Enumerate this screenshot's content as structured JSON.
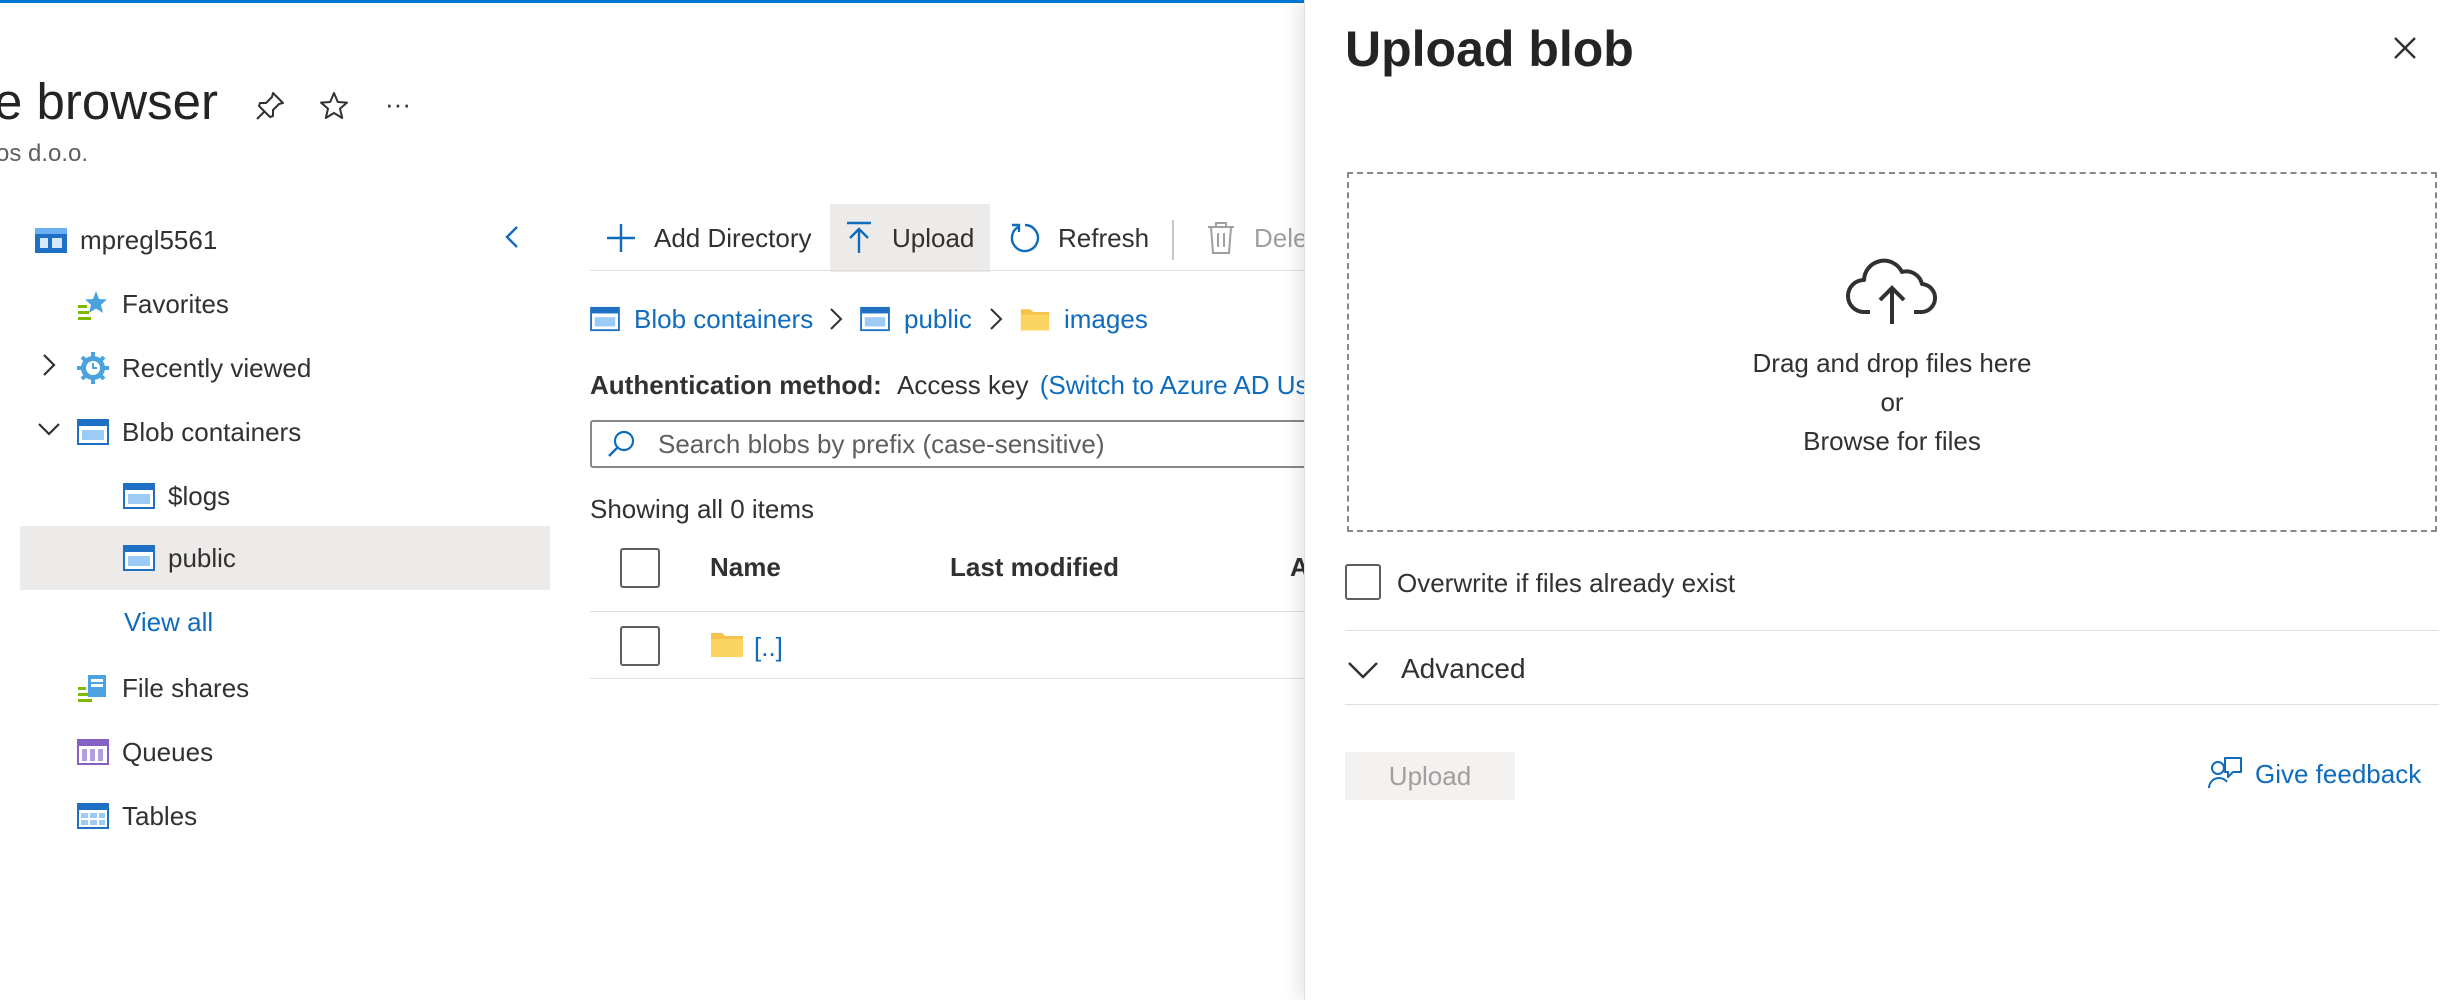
{
  "page": {
    "title": "e browser",
    "subtitle": "os d.o.o.",
    "pin_icon": "pin-icon",
    "star_icon": "star-icon",
    "more_label": "···"
  },
  "tree": {
    "account": "mpregl5561",
    "items": [
      {
        "label": "Favorites",
        "icon": "favorites-icon"
      },
      {
        "label": "Recently viewed",
        "icon": "recently-viewed-icon"
      },
      {
        "label": "Blob containers",
        "icon": "blob-container-icon"
      },
      {
        "label": "$logs",
        "icon": "container-icon"
      },
      {
        "label": "public",
        "icon": "container-icon",
        "selected": true
      },
      {
        "label": "View all"
      },
      {
        "label": "File shares",
        "icon": "file-share-icon"
      },
      {
        "label": "Queues",
        "icon": "queue-icon"
      },
      {
        "label": "Tables",
        "icon": "table-icon"
      }
    ]
  },
  "toolbar": {
    "add_directory": "Add Directory",
    "upload": "Upload",
    "refresh": "Refresh",
    "delete": "Dele"
  },
  "breadcrumb": [
    "Blob containers",
    "public",
    "images"
  ],
  "auth": {
    "label": "Authentication method:",
    "value": "Access key",
    "switch_link": "(Switch to Azure AD User"
  },
  "search": {
    "placeholder": "Search blobs by prefix (case-sensitive)"
  },
  "listing": {
    "count_text": "Showing all 0 items",
    "columns": [
      "Name",
      "Last modified",
      "A"
    ],
    "rows": [
      {
        "name": "[..]"
      }
    ]
  },
  "upload_panel": {
    "title": "Upload blob",
    "drop_text": "Drag and drop files here",
    "or_text": "or",
    "browse_link": "Browse for files",
    "overwrite_label": "Overwrite if files already exist",
    "advanced_label": "Advanced",
    "upload_button": "Upload",
    "feedback_link": "Give feedback"
  },
  "colors": {
    "accent": "#0078d4",
    "link": "#0f6cbd",
    "folder": "#f5c34d"
  }
}
